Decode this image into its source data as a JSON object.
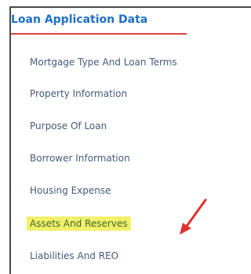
{
  "sidebar": {
    "title": "Loan Application Data",
    "items": [
      {
        "label": "Mortgage Type And Loan Terms"
      },
      {
        "label": "Property Information"
      },
      {
        "label": "Purpose Of Loan"
      },
      {
        "label": "Borrower Information"
      },
      {
        "label": "Housing Expense"
      },
      {
        "label": "Assets And Reserves"
      },
      {
        "label": "Liabilities And REO"
      }
    ]
  },
  "colors": {
    "accent": "#1f6fc9",
    "underline": "#e04040",
    "highlight": "#f2f06a",
    "annotation_arrow": "#e03030"
  }
}
